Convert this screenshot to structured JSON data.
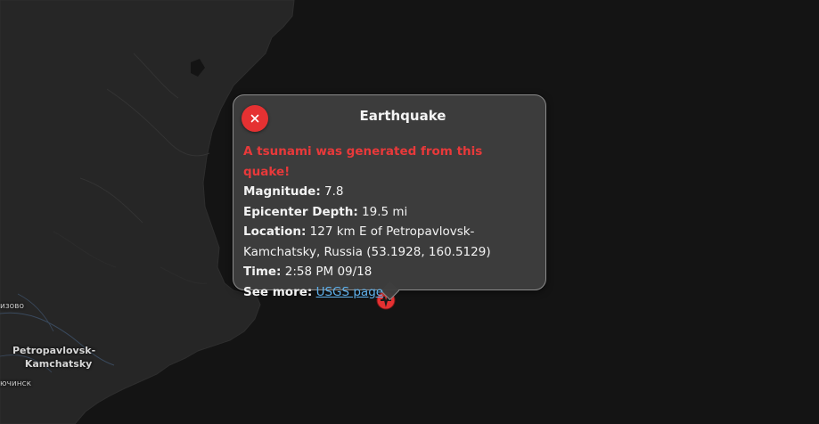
{
  "map": {
    "place_labels": {
      "top_left_partial": "изово",
      "city_line1": "Petropavlovsk-",
      "city_line2": "Kamchatsky",
      "bottom_partial": "ючинск"
    },
    "marker_icon": "earthquake-marker-icon",
    "colors": {
      "water": "#141414",
      "land": "#262626",
      "marker": "#e53132"
    }
  },
  "popup": {
    "title": "Earthquake",
    "close_icon": "close-icon",
    "tsunami_warning": "A tsunami was generated from this quake!",
    "magnitude_label": "Magnitude:",
    "magnitude_value": "7.8",
    "depth_label": "Epicenter Depth:",
    "depth_value": "19.5 mi",
    "location_label": "Location:",
    "location_value_line1": "127 km E of Petropavlovsk-",
    "location_value_line2": "Kamchatsky, Russia (53.1928, 160.5129)",
    "time_label": "Time:",
    "time_value": "2:58 PM 09/18",
    "see_more_label": "See more:",
    "link_text": "USGS page",
    "colors": {
      "background": "#3e3e3e",
      "warning": "#e8393a",
      "link": "#5fb0ea",
      "close_button": "#e53132"
    }
  }
}
